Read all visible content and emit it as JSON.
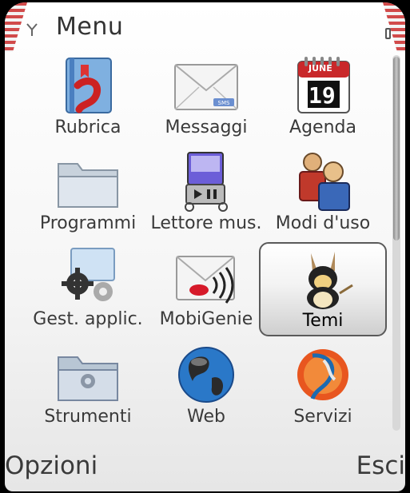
{
  "header": {
    "title": "Menu"
  },
  "menu": {
    "items": [
      {
        "label": "Rubrica",
        "icon": "contacts-book-icon"
      },
      {
        "label": "Messaggi",
        "icon": "sms-envelope-icon"
      },
      {
        "label": "Agenda",
        "icon": "calendar-icon",
        "calendar_month": "JUNE",
        "calendar_day": "19"
      },
      {
        "label": "Programmi",
        "icon": "folder-icon"
      },
      {
        "label": "Lettore mus.",
        "icon": "music-player-icon"
      },
      {
        "label": "Modi d'uso",
        "icon": "profiles-people-icon"
      },
      {
        "label": "Gest. applic.",
        "icon": "app-manager-gears-icon"
      },
      {
        "label": "MobiGenie",
        "icon": "mobigenie-icon"
      },
      {
        "label": "Temi",
        "icon": "themes-mascot-icon",
        "selected": true
      },
      {
        "label": "Strumenti",
        "icon": "tools-folder-icon"
      },
      {
        "label": "Web",
        "icon": "globe-icon"
      },
      {
        "label": "Servizi",
        "icon": "services-icon"
      }
    ]
  },
  "softkeys": {
    "left": "Opzioni",
    "right": "Esci"
  },
  "colors": {
    "accent_red": "#c92a2a",
    "text": "#3a3a3a"
  }
}
